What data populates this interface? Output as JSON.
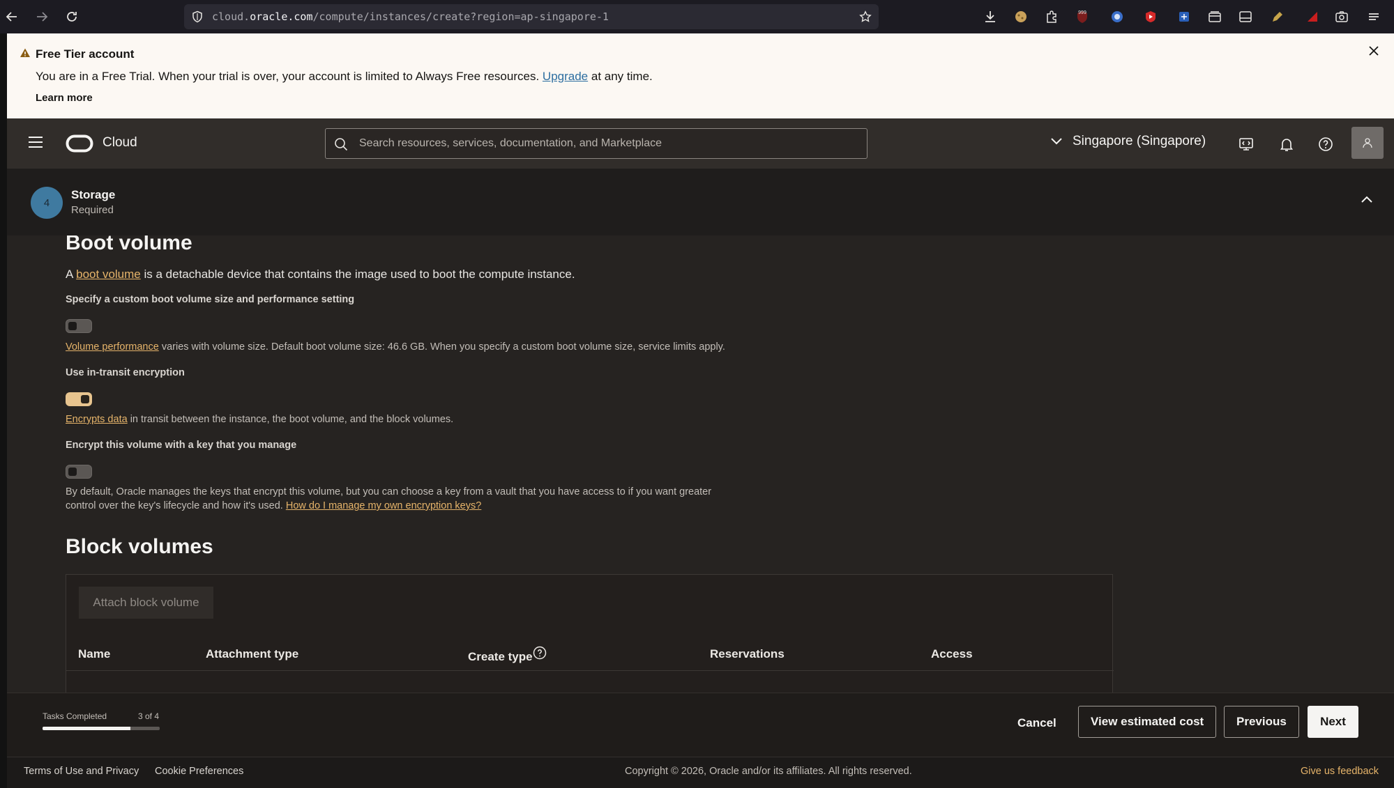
{
  "browser": {
    "url_prefix": "cloud.",
    "url_host": "oracle.com",
    "url_path": "/compute/instances/create?region=ap-singapore-1",
    "ext_badge": "999"
  },
  "banner": {
    "title": "Free Tier account",
    "message_before": "You are in a Free Trial. When your trial is over, your account is limited to Always Free resources.",
    "upgrade_link": "Upgrade",
    "message_after": "at any time.",
    "learn_more": "Learn more"
  },
  "header": {
    "brand": "Cloud",
    "search_placeholder": "Search resources, services, documentation, and Marketplace",
    "region": "Singapore (Singapore)"
  },
  "step": {
    "number": "4",
    "title": "Storage",
    "subtitle": "Required"
  },
  "boot_volume": {
    "heading": "Boot volume",
    "desc_prefix": "A",
    "desc_link": "boot volume",
    "desc_suffix": "is a detachable device that contains the image used to boot the compute instance.",
    "custom_size_label": "Specify a custom boot volume size and performance setting",
    "custom_size_on": false,
    "perf_link": "Volume performance",
    "perf_text": "varies with volume size. Default boot volume size: 46.6 GB. When you specify a custom boot volume size, service limits apply.",
    "transit_label": "Use in-transit encryption",
    "transit_on": true,
    "transit_link": "Encrypts data",
    "transit_text": "in transit between the instance, the boot volume, and the block volumes.",
    "key_label": "Encrypt this volume with a key that you manage",
    "key_on": false,
    "key_help_line1": "By default, Oracle manages the keys that encrypt this volume, but you can choose a key from a vault that you have access to if you want greater",
    "key_help_line2": "control over the key's lifecycle and how it's used.",
    "key_help_link": "How do I manage my own encryption keys?"
  },
  "block_volumes": {
    "heading": "Block volumes",
    "attach_button": "Attach block volume",
    "columns": [
      "Name",
      "Attachment type",
      "Create type",
      "Reservations",
      "Access"
    ]
  },
  "bottom_bar": {
    "tasks_label": "Tasks Completed",
    "tasks_value": "3 of 4",
    "tasks_progress": 0.75,
    "cancel": "Cancel",
    "view_cost": "View estimated cost",
    "previous": "Previous",
    "next": "Next"
  },
  "footer": {
    "terms": "Terms of Use and Privacy",
    "cookies": "Cookie Preferences",
    "copyright": "Copyright © 2026, Oracle and/or its affiliates. All rights reserved.",
    "feedback": "Give us feedback"
  },
  "colors": {
    "accent_link": "#e6b46a",
    "toggle_on": "#e7c48f",
    "banner_bg": "#fcf8f3",
    "header_bg": "#312d2a",
    "step_badge": "#3f7aa0"
  }
}
